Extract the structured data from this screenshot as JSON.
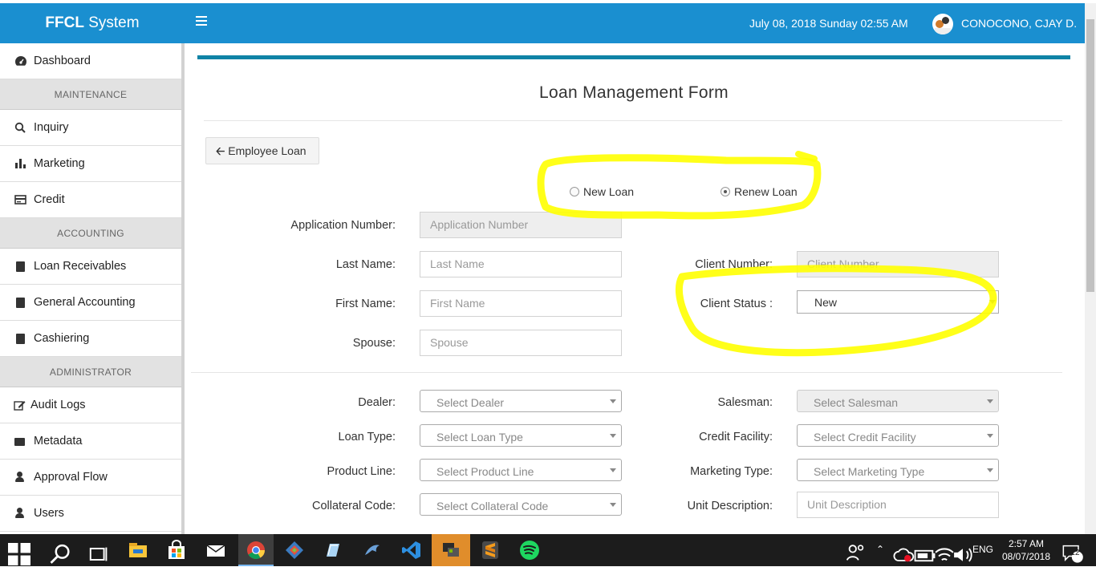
{
  "app": {
    "title_bold": "FFCL",
    "title_rest": " System"
  },
  "header": {
    "datetime": "July 08, 2018 Sunday 02:55 AM",
    "user": "CONOCONO, CJAY D."
  },
  "sidebar": {
    "items": [
      {
        "label": "Dashboard",
        "icon": "dashboard-icon"
      },
      {
        "section": "MAINTENANCE"
      },
      {
        "label": "Inquiry",
        "icon": "search-icon"
      },
      {
        "label": "Marketing",
        "icon": "bar-chart-icon"
      },
      {
        "label": "Credit",
        "icon": "credit-card-icon"
      },
      {
        "section": "ACCOUNTING"
      },
      {
        "label": "Loan Receivables",
        "icon": "book-icon"
      },
      {
        "label": "General Accounting",
        "icon": "book-icon"
      },
      {
        "label": "Cashiering",
        "icon": "book-icon"
      },
      {
        "section": "ADMINISTRATOR"
      },
      {
        "label": "Audit Logs",
        "icon": "edit-icon"
      },
      {
        "label": "Metadata",
        "icon": "folder-icon"
      },
      {
        "label": "Approval Flow",
        "icon": "user-icon"
      },
      {
        "label": "Users",
        "icon": "user-icon"
      }
    ]
  },
  "form": {
    "title": "Loan Management Form",
    "back_button": "Employee Loan",
    "radio_new": "New Loan",
    "radio_renew": "Renew Loan",
    "selected_loan": "renew",
    "application_number": {
      "label": "Application Number:",
      "placeholder": "Application Number"
    },
    "last_name": {
      "label": "Last Name:",
      "placeholder": "Last Name"
    },
    "first_name": {
      "label": "First Name:",
      "placeholder": "First Name"
    },
    "spouse": {
      "label": "Spouse:",
      "placeholder": "Spouse"
    },
    "client_number": {
      "label": "Client Number:",
      "placeholder": "Client Number"
    },
    "client_status": {
      "label": "Client Status :",
      "value": "New"
    },
    "dealer": {
      "label": "Dealer:",
      "placeholder": "Select Dealer"
    },
    "loan_type": {
      "label": "Loan Type:",
      "placeholder": "Select Loan Type"
    },
    "product_line": {
      "label": "Product Line:",
      "placeholder": "Select Product Line"
    },
    "collateral_code": {
      "label": "Collateral Code:",
      "placeholder": "Select Collateral Code"
    },
    "salesman": {
      "label": "Salesman:",
      "placeholder": "Select Salesman"
    },
    "credit_facility": {
      "label": "Credit Facility:",
      "placeholder": "Select Credit Facility"
    },
    "marketing_type": {
      "label": "Marketing Type:",
      "placeholder": "Select Marketing Type"
    },
    "unit_description": {
      "label": "Unit Description:",
      "placeholder": "Unit Description"
    }
  },
  "taskbar": {
    "lang": "ENG",
    "time": "2:57 AM",
    "date": "08/07/2018",
    "notifications": "12"
  },
  "colors": {
    "header": "#1a8fd0",
    "card_border": "#0f83a6",
    "highlight": "#ffff00"
  }
}
